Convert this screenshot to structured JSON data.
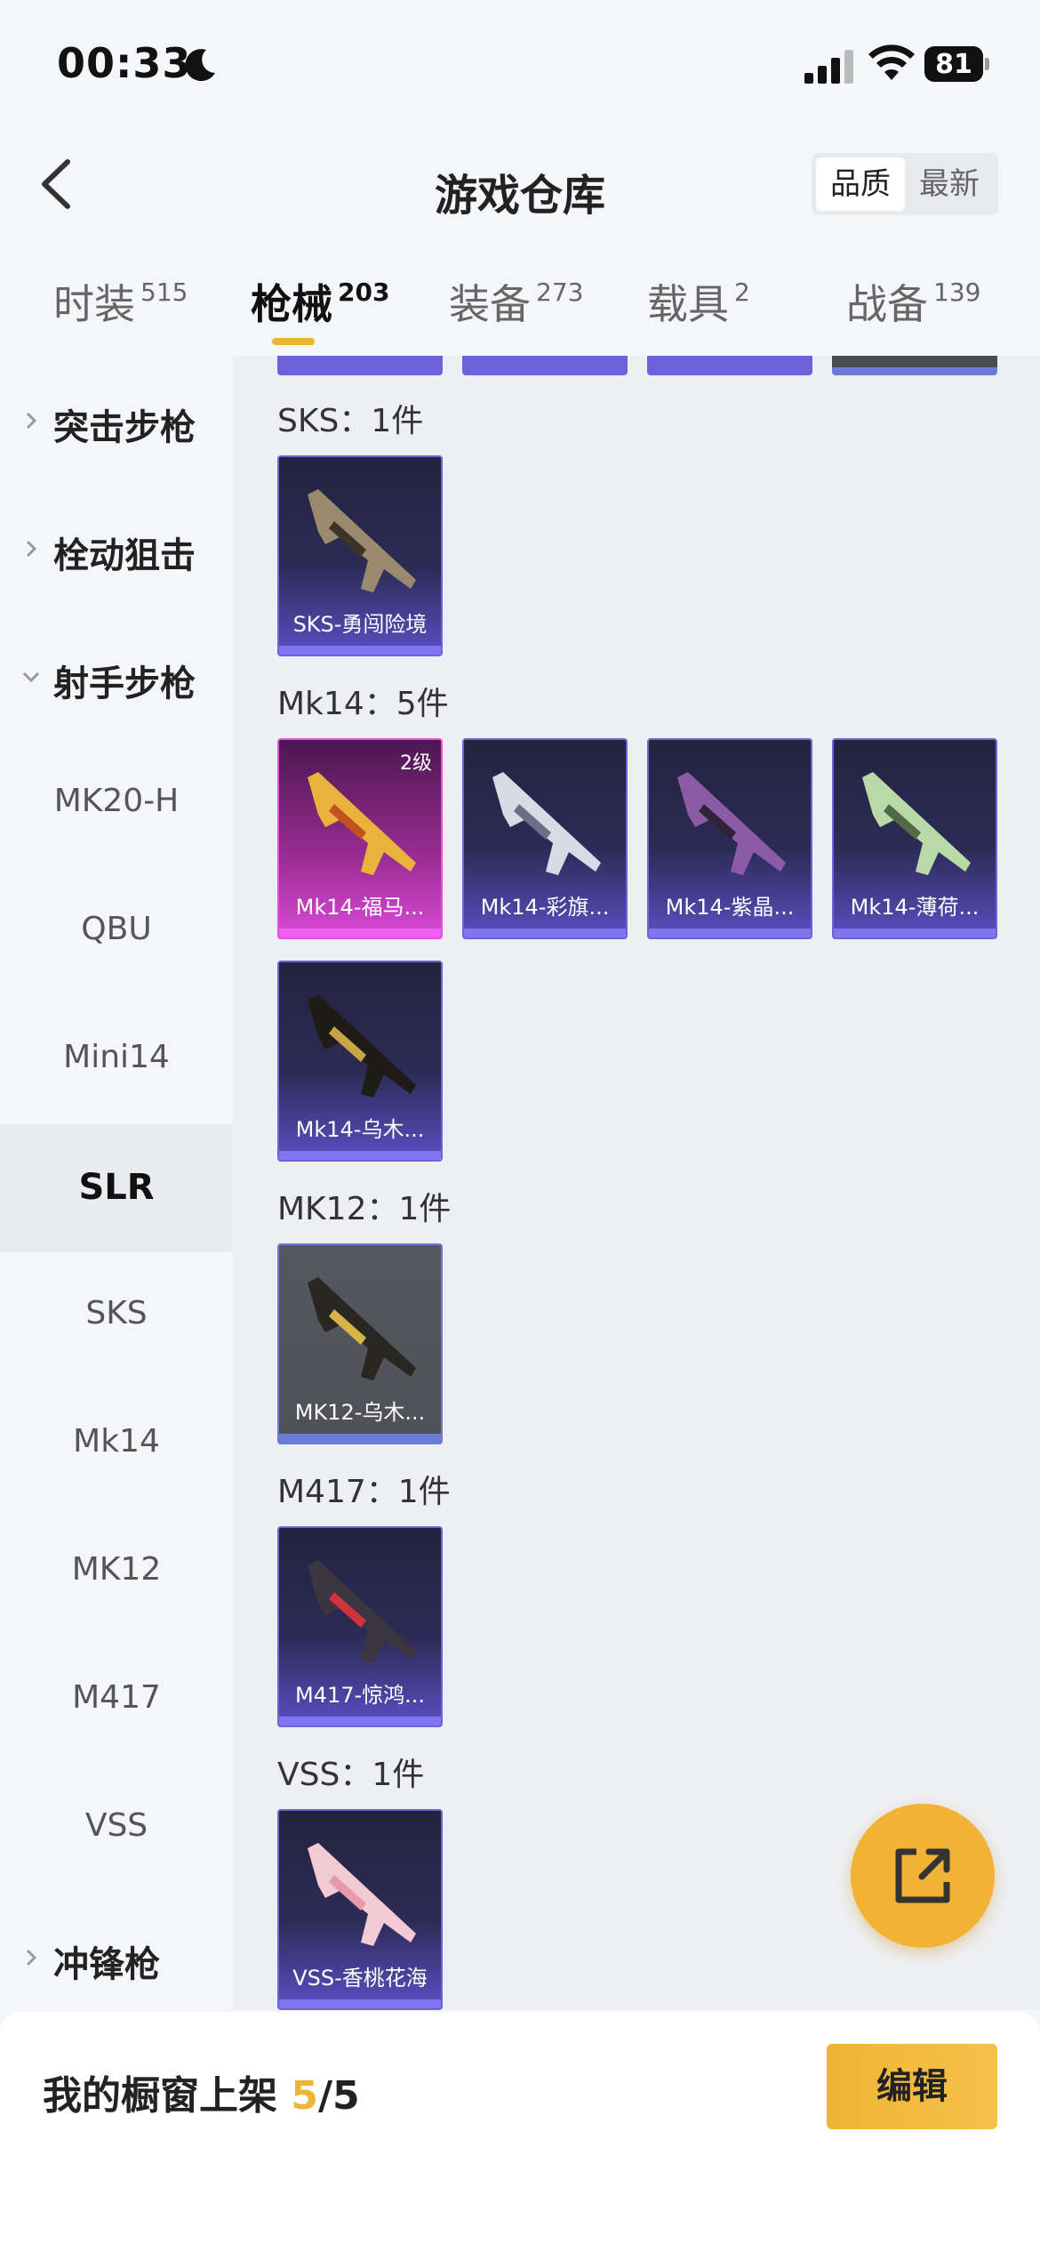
{
  "status_bar": {
    "time": "00:33",
    "battery": "81",
    "icons": [
      "moon-icon",
      "signal-icon",
      "wifi-icon",
      "battery-icon"
    ]
  },
  "header": {
    "title": "游戏仓库",
    "sort_options": [
      "品质",
      "最新"
    ]
  },
  "tabs": [
    {
      "label": "时装",
      "count": "515"
    },
    {
      "label": "枪械",
      "count": "203"
    },
    {
      "label": "装备",
      "count": "273"
    },
    {
      "label": "载具",
      "count": "2"
    },
    {
      "label": "战备",
      "count": "139"
    }
  ],
  "sidebar": [
    {
      "label": "突击步枪",
      "group": true
    },
    {
      "label": "栓动狙击",
      "group": true
    },
    {
      "label": "射手步枪",
      "group": true
    },
    {
      "label": "MK20-H"
    },
    {
      "label": "QBU"
    },
    {
      "label": "Mini14"
    },
    {
      "label": "SLR"
    },
    {
      "label": "SKS"
    },
    {
      "label": "Mk14"
    },
    {
      "label": "MK12"
    },
    {
      "label": "M417"
    },
    {
      "label": "VSS"
    },
    {
      "label": "冲锋枪",
      "group": true
    }
  ],
  "sections": [
    {
      "title": "SKS：1件",
      "items": [
        {
          "name": "SKS-勇闯险境"
        }
      ]
    },
    {
      "title": "Mk14：5件",
      "items": [
        {
          "name": "Mk14-福马...",
          "level": "2级"
        },
        {
          "name": "Mk14-彩旗..."
        },
        {
          "name": "Mk14-紫晶..."
        },
        {
          "name": "Mk14-薄荷..."
        },
        {
          "name": "Mk14-乌木..."
        }
      ]
    },
    {
      "title": "MK12：1件",
      "items": [
        {
          "name": "MK12-乌木..."
        }
      ]
    },
    {
      "title": "M417：1件",
      "items": [
        {
          "name": "M417-惊鸿..."
        }
      ]
    },
    {
      "title": "VSS：1件",
      "items": [
        {
          "name": "VSS-香桃花海"
        }
      ]
    }
  ],
  "bottom": {
    "label": "我的橱窗上架",
    "count": "5",
    "total": "/5",
    "edit_label": "编辑"
  },
  "colors": {
    "accent": "#f0b434",
    "card_purple": "#6d63d8",
    "card_pink": "#e54fe4"
  }
}
